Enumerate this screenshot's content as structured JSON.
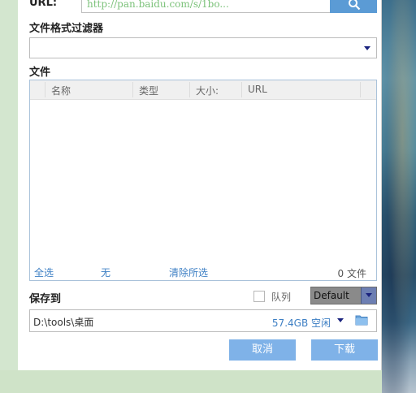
{
  "url": {
    "label": "URL:",
    "value": "http://pan.baidu.com/s/1bo..."
  },
  "filter": {
    "title": "文件格式过滤器",
    "value": ""
  },
  "files": {
    "title": "文件",
    "columns": [
      "名称",
      "类型",
      "大小:",
      "URL"
    ],
    "select_all": "全选",
    "select_none": "无",
    "clear_selected": "清除所选",
    "count": "0 文件"
  },
  "save": {
    "title": "保存到",
    "queue_label": "队列",
    "queue_checked": false,
    "queue_select": "Default",
    "path": "D:\\tools\\桌面",
    "free_space": "57.4GB 空闲"
  },
  "buttons": {
    "cancel": "取消",
    "download": "下载"
  },
  "colors": {
    "accent": "#5b9bd5",
    "button": "#7fb2e8",
    "link": "#3d7fc4"
  },
  "icons": [
    "search-icon",
    "chevron-down-icon",
    "folder-icon"
  ]
}
